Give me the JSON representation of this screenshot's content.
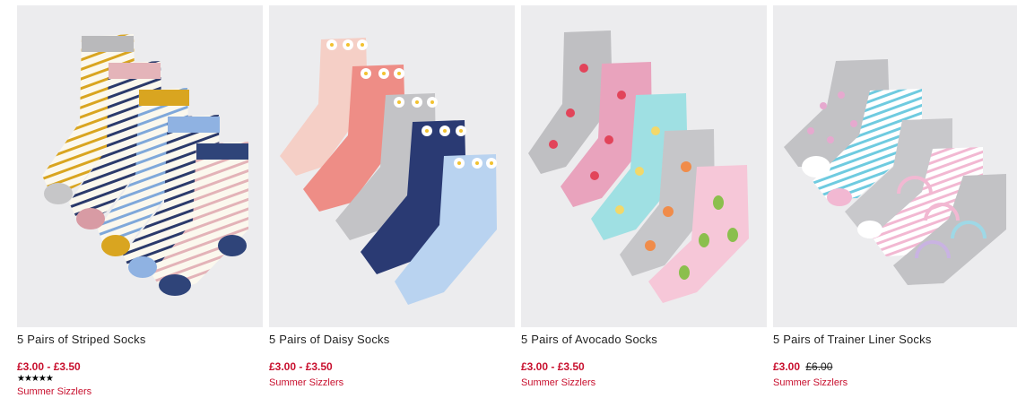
{
  "products": [
    {
      "title": "5 Pairs of Striped Socks",
      "price": "£3.00 - £3.50",
      "was_price": "",
      "rating_stars": "★★★★★",
      "rating_value": 5,
      "promo": "Summer Sizzlers"
    },
    {
      "title": "5 Pairs of Daisy Socks",
      "price": "£3.00 - £3.50",
      "was_price": "",
      "promo": "Summer Sizzlers"
    },
    {
      "title": "5 Pairs of Avocado Socks",
      "price": "£3.00 - £3.50",
      "was_price": "",
      "promo": "Summer Sizzlers"
    },
    {
      "title": "5 Pairs of Trainer Liner Socks",
      "price": "£3.00",
      "was_price": "£6.00",
      "promo": "Summer Sizzlers"
    }
  ],
  "colors": {
    "price_red": "#c8102e",
    "image_bg": "#ececee"
  }
}
